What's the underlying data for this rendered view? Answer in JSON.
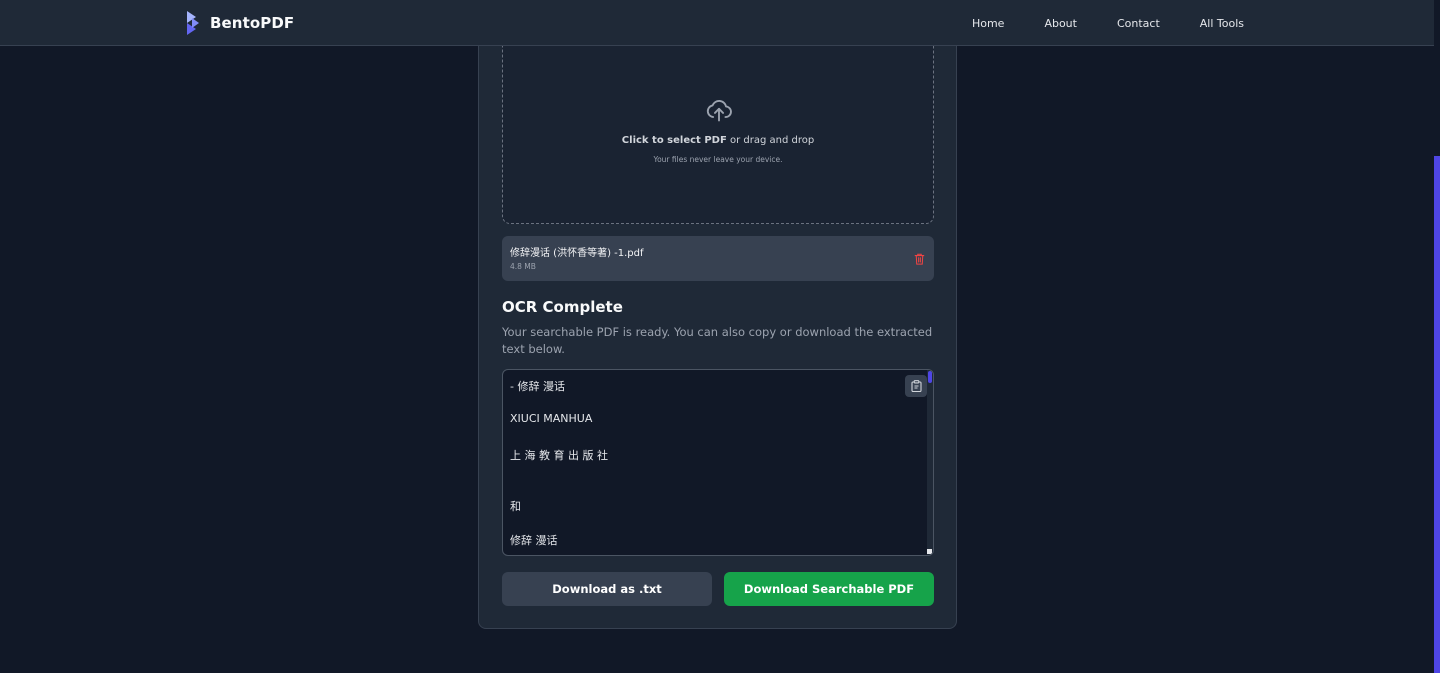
{
  "navbar": {
    "brand": "BentoPDF",
    "links": [
      "Home",
      "About",
      "Contact",
      "All Tools"
    ]
  },
  "dropzone": {
    "main_bold": "Click to select PDF",
    "main_rest": " or drag and drop",
    "sub": "Your files never leave your device.",
    "icon": "cloud-upload-icon"
  },
  "file": {
    "name": "修辞漫话 (洪怀香等著) -1.pdf",
    "size": "4.8 MB",
    "delete_icon": "trash-icon"
  },
  "ocr": {
    "title": "OCR Complete",
    "description": "Your searchable PDF is ready. You can also copy or download the extracted text below.",
    "text_lines": [
      "- 修辞 漫话",
      "XIUCI MANHUA",
      "上 海 教 育 出 版 社",
      "和",
      "修辞 漫话"
    ],
    "copy_icon": "clipboard-icon"
  },
  "buttons": {
    "download_txt": "Download as .txt",
    "download_pdf": "Download Searchable PDF"
  },
  "colors": {
    "accent": "#4f46e5",
    "success": "#16a34a",
    "danger": "#ef4444",
    "background": "#111827",
    "surface": "#1f2937"
  }
}
